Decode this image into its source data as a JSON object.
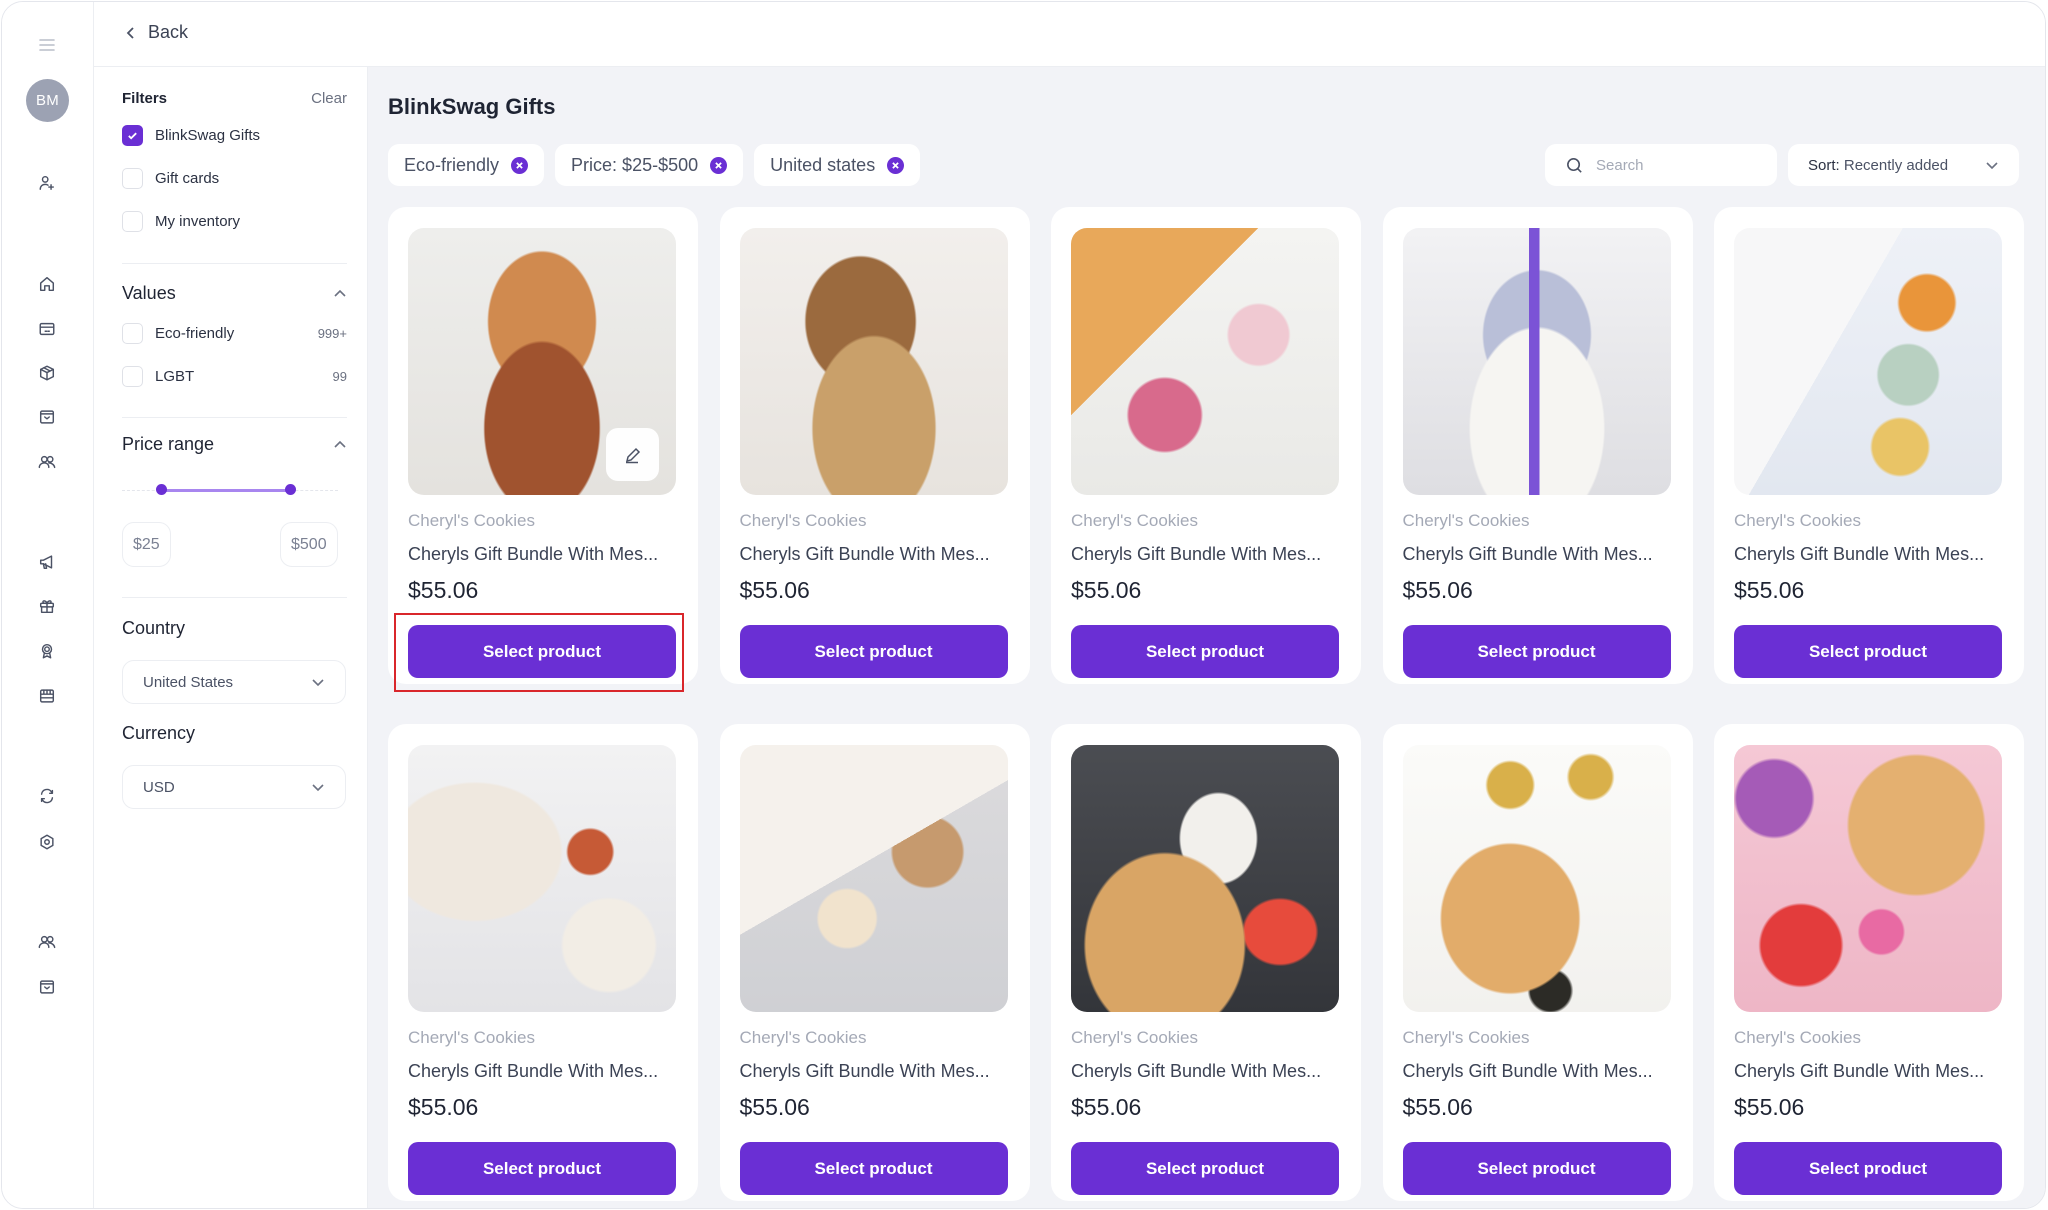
{
  "rail": {
    "avatar_initials": "BM",
    "items": [
      {
        "name": "menu-icon"
      },
      {
        "name": "add-user-icon"
      },
      {
        "name": "home-icon"
      },
      {
        "name": "credit-card-icon"
      },
      {
        "name": "package-icon"
      },
      {
        "name": "inbox-icon"
      },
      {
        "name": "users-icon"
      },
      {
        "name": "megaphone-icon"
      },
      {
        "name": "gift-icon"
      },
      {
        "name": "award-icon"
      },
      {
        "name": "store-icon"
      },
      {
        "name": "refresh-icon"
      },
      {
        "name": "settings-icon"
      },
      {
        "name": "users-icon"
      },
      {
        "name": "inbox-icon"
      }
    ]
  },
  "topbar": {
    "back_label": "Back"
  },
  "filters": {
    "title": "Filters",
    "clear_label": "Clear",
    "sources": [
      {
        "label": "BlinkSwag Gifts",
        "checked": true
      },
      {
        "label": "Gift cards",
        "checked": false
      },
      {
        "label": "My inventory",
        "checked": false
      }
    ],
    "values": {
      "title": "Values",
      "items": [
        {
          "label": "Eco-friendly",
          "count": "999+",
          "checked": false
        },
        {
          "label": "LGBT",
          "count": "99",
          "checked": false
        }
      ]
    },
    "price_range": {
      "title": "Price range",
      "min_label": "$25",
      "max_label": "$500",
      "low_fraction": 0.18,
      "high_fraction": 0.78
    },
    "country": {
      "title": "Country",
      "value": "United States"
    },
    "currency": {
      "title": "Currency",
      "value": "USD"
    }
  },
  "main": {
    "title": "BlinkSwag Gifts",
    "chips": [
      {
        "label": "Eco-friendly"
      },
      {
        "label": "Price: $25-$500"
      },
      {
        "label": "United states"
      }
    ],
    "search": {
      "placeholder": "Search",
      "value": ""
    },
    "sort": {
      "prefix": "Sort:",
      "value": "Recently added"
    },
    "products": [
      {
        "brand": "Cheryl's Cookies",
        "name": "Cheryls Gift Bundle With Mes...",
        "price": "$55.06",
        "button": "Select product",
        "image": "gift-basket-snacks",
        "has_edit": true,
        "highlighted": true
      },
      {
        "brand": "Cheryl's Cookies",
        "name": "Cheryls Gift Bundle With Mes...",
        "price": "$55.06",
        "button": "Select product",
        "image": "gift-basket-cookies"
      },
      {
        "brand": "Cheryl's Cookies",
        "name": "Cheryls Gift Bundle With Mes...",
        "price": "$55.06",
        "button": "Select product",
        "image": "holiday-sweets-box"
      },
      {
        "brand": "Cheryl's Cookies",
        "name": "Cheryls Gift Bundle With Mes...",
        "price": "$55.06",
        "button": "Select product",
        "image": "spa-basket"
      },
      {
        "brand": "Cheryl's Cookies",
        "name": "Cheryls Gift Bundle With Mes...",
        "price": "$55.06",
        "button": "Select product",
        "image": "tea-time-box"
      },
      {
        "brand": "Cheryl's Cookies",
        "name": "Cheryls Gift Bundle With Mes...",
        "price": "$55.06",
        "button": "Select product",
        "image": "pasta-kit"
      },
      {
        "brand": "Cheryl's Cookies",
        "name": "Cheryls Gift Bundle With Mes...",
        "price": "$55.06",
        "button": "Select product",
        "image": "dopo-snack-box"
      },
      {
        "brand": "Cheryl's Cookies",
        "name": "Cheryls Gift Bundle With Mes...",
        "price": "$55.06",
        "button": "Select product",
        "image": "popcorn-box"
      },
      {
        "brand": "Cheryl's Cookies",
        "name": "Cheryls Gift Bundle With Mes...",
        "price": "$55.06",
        "button": "Select product",
        "image": "holiday-treats-box"
      },
      {
        "brand": "Cheryl's Cookies",
        "name": "Cheryls Gift Bundle With Mes...",
        "price": "$55.06",
        "button": "Select product",
        "image": "pink-party-box"
      }
    ]
  },
  "colors": {
    "accent": "#6a2fd4",
    "background": "#f2f3f7",
    "highlight": "#d9262b"
  }
}
